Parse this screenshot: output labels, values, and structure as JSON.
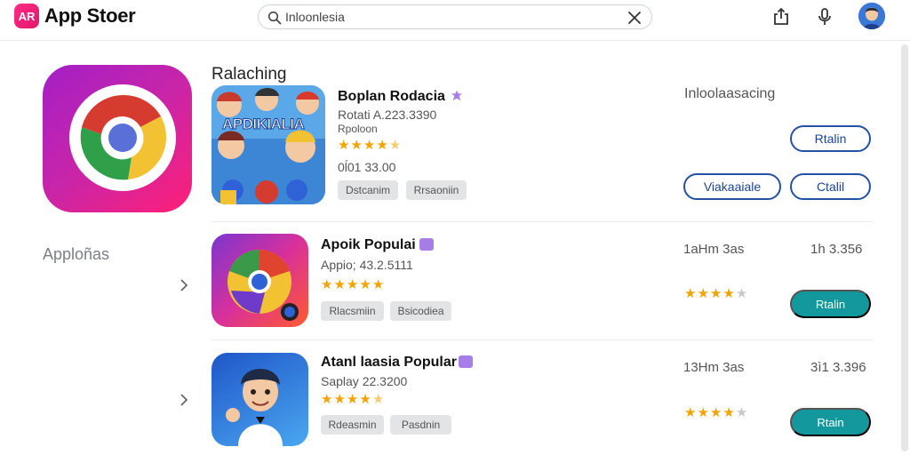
{
  "header": {
    "logo_text": "AR",
    "app_title": "App Stoer",
    "search_value": "Inloonlesia",
    "search_placeholder": "Search"
  },
  "sidebar": {
    "category_label": "Apploñas"
  },
  "main": {
    "section_title": "Ralaching",
    "featured": {
      "name": "Boplan Rodacia",
      "developer": "Rotati A.223.3390",
      "subtitle": "Rpoloon",
      "rating": 4.5,
      "downloads": "0ĺ01 33.00",
      "chips": [
        "Dstcanim",
        "Rrsaoniin"
      ],
      "status_text": "Inloolaasacing",
      "buttons": {
        "primary": "Rtalin",
        "secondary": "Viakaaiale",
        "tertiary": "Ctalil"
      },
      "tile_text": "APDIKIALIA"
    },
    "apps": [
      {
        "name": "Apoik Populai",
        "meta": "Appio; 43.2.5111",
        "rating": 5,
        "chips": [
          "Rlacsmiin",
          "Bsicodiea"
        ],
        "size": "1aHm 3as",
        "price": "1h 3.356",
        "right_rating": 4,
        "button": "Rtalin"
      },
      {
        "name": "Atanl laasia Popular",
        "meta": "Saplay 22.3200",
        "rating": 4.5,
        "chips": [
          "Rdeasmin",
          "Pasdnin"
        ],
        "size": "13Hm 3as",
        "price": "3ì1 3.396",
        "right_rating": 4,
        "button": "Rtain"
      }
    ]
  },
  "colors": {
    "accent_teal": "#12989d",
    "accent_blue": "#2451a6",
    "brand_pink": "#e2156b",
    "star": "#f4a300",
    "badge": "#a77de8"
  }
}
